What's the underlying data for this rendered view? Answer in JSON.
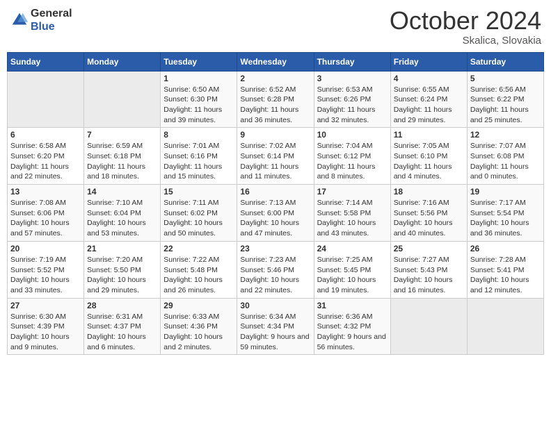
{
  "logo": {
    "general": "General",
    "blue": "Blue"
  },
  "title": "October 2024",
  "location": "Skalica, Slovakia",
  "weekdays": [
    "Sunday",
    "Monday",
    "Tuesday",
    "Wednesday",
    "Thursday",
    "Friday",
    "Saturday"
  ],
  "weeks": [
    [
      {
        "day": "",
        "sunrise": "",
        "sunset": "",
        "daylight": "",
        "empty": true
      },
      {
        "day": "",
        "sunrise": "",
        "sunset": "",
        "daylight": "",
        "empty": true
      },
      {
        "day": "1",
        "sunrise": "Sunrise: 6:50 AM",
        "sunset": "Sunset: 6:30 PM",
        "daylight": "Daylight: 11 hours and 39 minutes."
      },
      {
        "day": "2",
        "sunrise": "Sunrise: 6:52 AM",
        "sunset": "Sunset: 6:28 PM",
        "daylight": "Daylight: 11 hours and 36 minutes."
      },
      {
        "day": "3",
        "sunrise": "Sunrise: 6:53 AM",
        "sunset": "Sunset: 6:26 PM",
        "daylight": "Daylight: 11 hours and 32 minutes."
      },
      {
        "day": "4",
        "sunrise": "Sunrise: 6:55 AM",
        "sunset": "Sunset: 6:24 PM",
        "daylight": "Daylight: 11 hours and 29 minutes."
      },
      {
        "day": "5",
        "sunrise": "Sunrise: 6:56 AM",
        "sunset": "Sunset: 6:22 PM",
        "daylight": "Daylight: 11 hours and 25 minutes."
      }
    ],
    [
      {
        "day": "6",
        "sunrise": "Sunrise: 6:58 AM",
        "sunset": "Sunset: 6:20 PM",
        "daylight": "Daylight: 11 hours and 22 minutes."
      },
      {
        "day": "7",
        "sunrise": "Sunrise: 6:59 AM",
        "sunset": "Sunset: 6:18 PM",
        "daylight": "Daylight: 11 hours and 18 minutes."
      },
      {
        "day": "8",
        "sunrise": "Sunrise: 7:01 AM",
        "sunset": "Sunset: 6:16 PM",
        "daylight": "Daylight: 11 hours and 15 minutes."
      },
      {
        "day": "9",
        "sunrise": "Sunrise: 7:02 AM",
        "sunset": "Sunset: 6:14 PM",
        "daylight": "Daylight: 11 hours and 11 minutes."
      },
      {
        "day": "10",
        "sunrise": "Sunrise: 7:04 AM",
        "sunset": "Sunset: 6:12 PM",
        "daylight": "Daylight: 11 hours and 8 minutes."
      },
      {
        "day": "11",
        "sunrise": "Sunrise: 7:05 AM",
        "sunset": "Sunset: 6:10 PM",
        "daylight": "Daylight: 11 hours and 4 minutes."
      },
      {
        "day": "12",
        "sunrise": "Sunrise: 7:07 AM",
        "sunset": "Sunset: 6:08 PM",
        "daylight": "Daylight: 11 hours and 0 minutes."
      }
    ],
    [
      {
        "day": "13",
        "sunrise": "Sunrise: 7:08 AM",
        "sunset": "Sunset: 6:06 PM",
        "daylight": "Daylight: 10 hours and 57 minutes."
      },
      {
        "day": "14",
        "sunrise": "Sunrise: 7:10 AM",
        "sunset": "Sunset: 6:04 PM",
        "daylight": "Daylight: 10 hours and 53 minutes."
      },
      {
        "day": "15",
        "sunrise": "Sunrise: 7:11 AM",
        "sunset": "Sunset: 6:02 PM",
        "daylight": "Daylight: 10 hours and 50 minutes."
      },
      {
        "day": "16",
        "sunrise": "Sunrise: 7:13 AM",
        "sunset": "Sunset: 6:00 PM",
        "daylight": "Daylight: 10 hours and 47 minutes."
      },
      {
        "day": "17",
        "sunrise": "Sunrise: 7:14 AM",
        "sunset": "Sunset: 5:58 PM",
        "daylight": "Daylight: 10 hours and 43 minutes."
      },
      {
        "day": "18",
        "sunrise": "Sunrise: 7:16 AM",
        "sunset": "Sunset: 5:56 PM",
        "daylight": "Daylight: 10 hours and 40 minutes."
      },
      {
        "day": "19",
        "sunrise": "Sunrise: 7:17 AM",
        "sunset": "Sunset: 5:54 PM",
        "daylight": "Daylight: 10 hours and 36 minutes."
      }
    ],
    [
      {
        "day": "20",
        "sunrise": "Sunrise: 7:19 AM",
        "sunset": "Sunset: 5:52 PM",
        "daylight": "Daylight: 10 hours and 33 minutes."
      },
      {
        "day": "21",
        "sunrise": "Sunrise: 7:20 AM",
        "sunset": "Sunset: 5:50 PM",
        "daylight": "Daylight: 10 hours and 29 minutes."
      },
      {
        "day": "22",
        "sunrise": "Sunrise: 7:22 AM",
        "sunset": "Sunset: 5:48 PM",
        "daylight": "Daylight: 10 hours and 26 minutes."
      },
      {
        "day": "23",
        "sunrise": "Sunrise: 7:23 AM",
        "sunset": "Sunset: 5:46 PM",
        "daylight": "Daylight: 10 hours and 22 minutes."
      },
      {
        "day": "24",
        "sunrise": "Sunrise: 7:25 AM",
        "sunset": "Sunset: 5:45 PM",
        "daylight": "Daylight: 10 hours and 19 minutes."
      },
      {
        "day": "25",
        "sunrise": "Sunrise: 7:27 AM",
        "sunset": "Sunset: 5:43 PM",
        "daylight": "Daylight: 10 hours and 16 minutes."
      },
      {
        "day": "26",
        "sunrise": "Sunrise: 7:28 AM",
        "sunset": "Sunset: 5:41 PM",
        "daylight": "Daylight: 10 hours and 12 minutes."
      }
    ],
    [
      {
        "day": "27",
        "sunrise": "Sunrise: 6:30 AM",
        "sunset": "Sunset: 4:39 PM",
        "daylight": "Daylight: 10 hours and 9 minutes."
      },
      {
        "day": "28",
        "sunrise": "Sunrise: 6:31 AM",
        "sunset": "Sunset: 4:37 PM",
        "daylight": "Daylight: 10 hours and 6 minutes."
      },
      {
        "day": "29",
        "sunrise": "Sunrise: 6:33 AM",
        "sunset": "Sunset: 4:36 PM",
        "daylight": "Daylight: 10 hours and 2 minutes."
      },
      {
        "day": "30",
        "sunrise": "Sunrise: 6:34 AM",
        "sunset": "Sunset: 4:34 PM",
        "daylight": "Daylight: 9 hours and 59 minutes."
      },
      {
        "day": "31",
        "sunrise": "Sunrise: 6:36 AM",
        "sunset": "Sunset: 4:32 PM",
        "daylight": "Daylight: 9 hours and 56 minutes."
      },
      {
        "day": "",
        "sunrise": "",
        "sunset": "",
        "daylight": "",
        "empty": true
      },
      {
        "day": "",
        "sunrise": "",
        "sunset": "",
        "daylight": "",
        "empty": true
      }
    ]
  ]
}
